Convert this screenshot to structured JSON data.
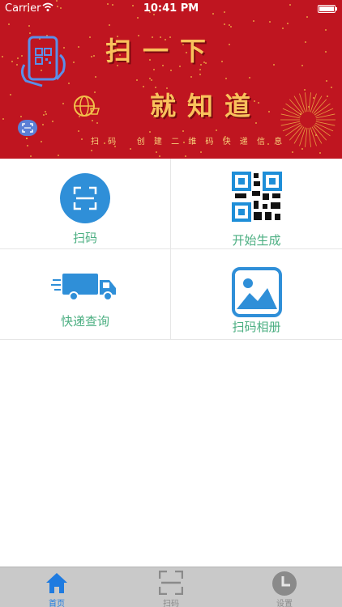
{
  "status_bar": {
    "carrier": "Carrier",
    "time": "10:41 PM",
    "wifi_icon": "wifi-icon",
    "battery_icon": "battery-icon"
  },
  "banner": {
    "line1": "扫一下",
    "line2": "就知道",
    "subtitle": "扫 码   创 建 二 维 码 快 递 信 息",
    "background_color": "#bf1520",
    "text_color": "#f9c25c"
  },
  "menu": {
    "label_color": "#4caf82",
    "items": [
      {
        "label": "扫码",
        "icon": "scan-icon"
      },
      {
        "label": "开始生成",
        "icon": "qr-code-icon"
      },
      {
        "label": "快递查询",
        "icon": "delivery-truck-icon"
      },
      {
        "label": "扫码相册",
        "icon": "photo-album-icon"
      }
    ]
  },
  "tabbar": {
    "active_color": "#1f7be0",
    "inactive_color": "#8a8a8a",
    "tabs": [
      {
        "label": "首页",
        "icon": "home-icon",
        "active": true
      },
      {
        "label": "扫码",
        "icon": "scan-icon",
        "active": false
      },
      {
        "label": "设置",
        "icon": "clock-icon",
        "active": false
      }
    ]
  }
}
